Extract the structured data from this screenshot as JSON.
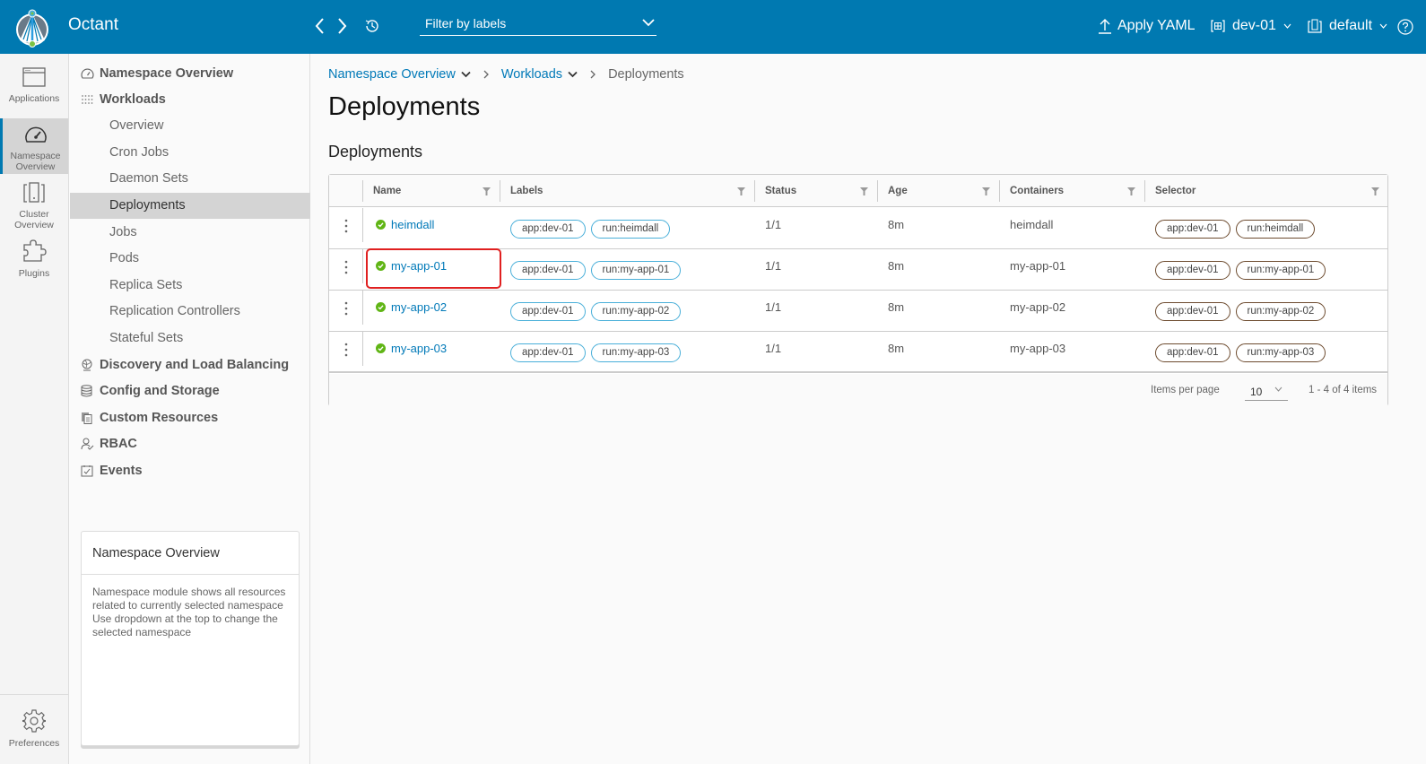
{
  "header": {
    "app_title": "Octant",
    "filter_placeholder": "Filter by labels",
    "apply_yaml_label": "Apply YAML",
    "cluster_context": "dev-01",
    "namespace": "default",
    "brand_color": "#0079b1"
  },
  "rail": {
    "items": [
      {
        "label": "Applications",
        "icon": "browser-window-icon"
      },
      {
        "label": "Namespace Overview",
        "icon": "dashboard-gauge-icon",
        "active": true
      },
      {
        "label": "Cluster Overview",
        "icon": "cluster-icon"
      },
      {
        "label": "Plugins",
        "icon": "puzzle-icon"
      }
    ],
    "preferences_label": "Preferences"
  },
  "nav": {
    "groups": [
      {
        "label": "Namespace Overview",
        "icon": "gauge-icon"
      },
      {
        "label": "Workloads",
        "icon": "grid-dots-icon"
      },
      {
        "label": "Discovery and Load Balancing",
        "icon": "network-globe-icon"
      },
      {
        "label": "Config and Storage",
        "icon": "database-icon"
      },
      {
        "label": "Custom Resources",
        "icon": "copy-docs-icon"
      },
      {
        "label": "RBAC",
        "icon": "user-check-icon"
      },
      {
        "label": "Events",
        "icon": "calendar-check-icon"
      }
    ],
    "workload_items": [
      "Overview",
      "Cron Jobs",
      "Daemon Sets",
      "Deployments",
      "Jobs",
      "Pods",
      "Replica Sets",
      "Replication Controllers",
      "Stateful Sets"
    ],
    "active_item": "Deployments",
    "info_card": {
      "title": "Namespace Overview",
      "body": "Namespace module shows all resources related to currently selected namespace Use dropdown at the top to change the selected namespace"
    }
  },
  "main": {
    "breadcrumb": {
      "items": [
        "Namespace Overview",
        "Workloads"
      ],
      "current": "Deployments"
    },
    "page_title": "Deployments",
    "section_title": "Deployments",
    "table": {
      "columns": [
        "Name",
        "Labels",
        "Status",
        "Age",
        "Containers",
        "Selector"
      ],
      "rows": [
        {
          "name": "heimdall",
          "labels": [
            "app:dev-01",
            "run:heimdall"
          ],
          "status": "1/1",
          "age": "8m",
          "containers": "heimdall",
          "selector": [
            "app:dev-01",
            "run:heimdall"
          ]
        },
        {
          "name": "my-app-01",
          "labels": [
            "app:dev-01",
            "run:my-app-01"
          ],
          "status": "1/1",
          "age": "8m",
          "containers": "my-app-01",
          "selector": [
            "app:dev-01",
            "run:my-app-01"
          ],
          "highlighted": true
        },
        {
          "name": "my-app-02",
          "labels": [
            "app:dev-01",
            "run:my-app-02"
          ],
          "status": "1/1",
          "age": "8m",
          "containers": "my-app-02",
          "selector": [
            "app:dev-01",
            "run:my-app-02"
          ]
        },
        {
          "name": "my-app-03",
          "labels": [
            "app:dev-01",
            "run:my-app-03"
          ],
          "status": "1/1",
          "age": "8m",
          "containers": "my-app-03",
          "selector": [
            "app:dev-01",
            "run:my-app-03"
          ]
        }
      ],
      "footer": {
        "items_per_page_label": "Items per page",
        "items_per_page": "10",
        "page_count": "1 - 4 of 4 items"
      }
    }
  }
}
